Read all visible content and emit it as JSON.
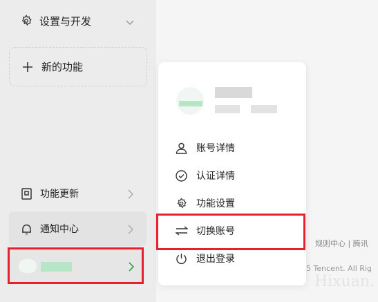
{
  "sidebar": {
    "settings_label": "设置与开发",
    "new_feature_label": "新的功能",
    "updates_label": "功能更新",
    "notifications_label": "通知中心"
  },
  "popup": {
    "items": [
      {
        "label": "账号详情",
        "icon": "user-icon"
      },
      {
        "label": "认证详情",
        "icon": "check-circle-icon"
      },
      {
        "label": "功能设置",
        "icon": "gear-icon"
      },
      {
        "label": "切换账号",
        "icon": "switch-arrows-icon"
      },
      {
        "label": "退出登录",
        "icon": "power-icon"
      }
    ]
  },
  "footer": {
    "links": "规则中心 | 腾讯",
    "copyright": "5 Tencent. All Rig"
  },
  "watermark": "Hixuan.",
  "colors": {
    "highlight": "#e8202a",
    "avatar_green": "#b7e6c6"
  }
}
